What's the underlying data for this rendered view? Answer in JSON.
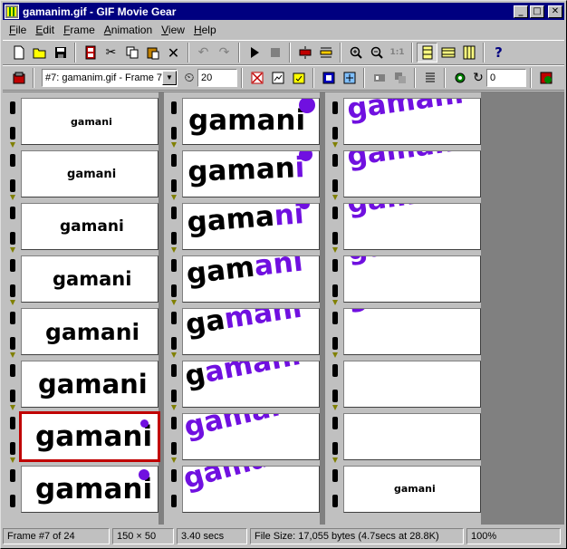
{
  "window": {
    "title": "gamanim.gif - GIF Movie Gear"
  },
  "menu": [
    {
      "label": "File",
      "key": "F",
      "rest": "ile"
    },
    {
      "label": "Edit",
      "key": "E",
      "rest": "dit"
    },
    {
      "label": "Frame",
      "key": "F",
      "rest": "rame"
    },
    {
      "label": "Animation",
      "key": "A",
      "rest": "nimation"
    },
    {
      "label": "View",
      "key": "V",
      "rest": "iew"
    },
    {
      "label": "Help",
      "key": "H",
      "rest": "elp"
    }
  ],
  "toolbar2": {
    "frame_select": "#7: gamanim.gif - Frame 7",
    "delay_value": "20",
    "loop_value": "0"
  },
  "frames": {
    "word": "gamani",
    "selected_index": 7,
    "strip3_last_word": "gamani"
  },
  "colors": {
    "accent_purple": "#7010e0",
    "selection": "#c00000",
    "titlebar": "#000080"
  },
  "status": {
    "frame": "Frame #7 of 24",
    "size": "150 × 50",
    "duration": "3.40 secs",
    "filesize": "File Size: 17,055 bytes  (4.7secs at 28.8K)",
    "zoom": "100%"
  }
}
